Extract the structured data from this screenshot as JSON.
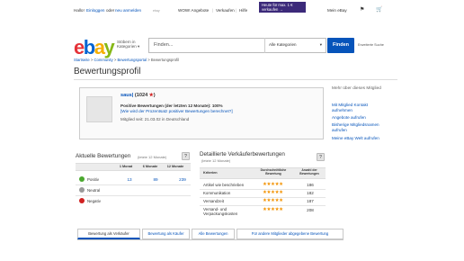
{
  "header": {
    "greeting": "Hallo!",
    "signin": "Einloggen",
    "or": "oder",
    "register": "neu anmelden",
    "logo_small": "ebay",
    "wow": "WOW! Angebote",
    "sell": "Verkaufen",
    "help": "Hilfe",
    "promo": "Heute für max. 1 € verkaufen →",
    "my_ebay": "Mein eBay",
    "bell_icon": "bell-icon",
    "cart_icon": "cart-icon"
  },
  "logo": {
    "e": "e",
    "b": "b",
    "a": "a",
    "y": "y"
  },
  "browse": {
    "line1": "Stöbern in",
    "line2": "Kategorien",
    "chevron": "▾"
  },
  "search": {
    "placeholder": "Finden...",
    "category": "Alle Kategorien",
    "button": "Finden",
    "advanced": "Erweiterte Suche"
  },
  "breadcrumb": {
    "items": [
      "Startseite",
      "Community",
      "Bewertungsportal",
      "Bewertungsprofil"
    ],
    "sep": ">"
  },
  "page_title": "Bewertungsprofil",
  "profile": {
    "username": "saus|",
    "score_open": "(",
    "score": "1024",
    "score_close": ")",
    "star": "★",
    "positive": "Positive Bewertungen (der letzten 12 Monate): 100%",
    "why": "[Wie wird der Prozentsatz positiver Bewertungen berechnet?]",
    "member_since": "Mitglied seit: 21.03.02 in Deutschland"
  },
  "sidebar": {
    "title": "Mehr über dieses Mitglied",
    "links": [
      "Mit Mitglied Kontakt aufnehmen",
      "Angebote aufrufen",
      "Bisherige Mitgliedsnamen aufrufen",
      "Meine eBay Welt aufrufen"
    ]
  },
  "current_ratings": {
    "title": "Aktuelle Bewertungen",
    "subtitle": "(letzte 12 Monate)",
    "help": "?",
    "columns": [
      "1 Monat",
      "6 Monate",
      "12 Monate"
    ],
    "rows": [
      {
        "label": "Positiv",
        "color": "#4aa82e",
        "values": [
          "13",
          "89",
          "239"
        ]
      },
      {
        "label": "Neutral",
        "color": "#9a9a9a",
        "values": [
          "",
          "",
          ""
        ]
      },
      {
        "label": "Negativ",
        "color": "#d02020",
        "values": [
          "",
          "",
          ""
        ]
      }
    ]
  },
  "detailed_ratings": {
    "title": "Detaillierte Verkäuferbewertungen",
    "subtitle": "(letzte 12 Monate)",
    "help": "?",
    "columns": [
      "Kriterien",
      "Durchschnittliche Bewertung",
      "Anzahl der Bewertungen"
    ],
    "rows": [
      {
        "label": "Artikel wie beschrieben",
        "stars": "★★★★★",
        "count": "186"
      },
      {
        "label": "Kommunikation",
        "stars": "★★★★★",
        "count": "182"
      },
      {
        "label": "Versandzeit",
        "stars": "★★★★★",
        "count": "187"
      },
      {
        "label": "Versand- und Verpackungskosten",
        "stars": "★★★★★",
        "count": "208"
      }
    ]
  },
  "tabs": [
    "Bewertung als Verkäufer",
    "Bewertung als Käufer",
    "Alle Bewertungen",
    "Für andere Mitglieder abgegebene Bewertung"
  ]
}
